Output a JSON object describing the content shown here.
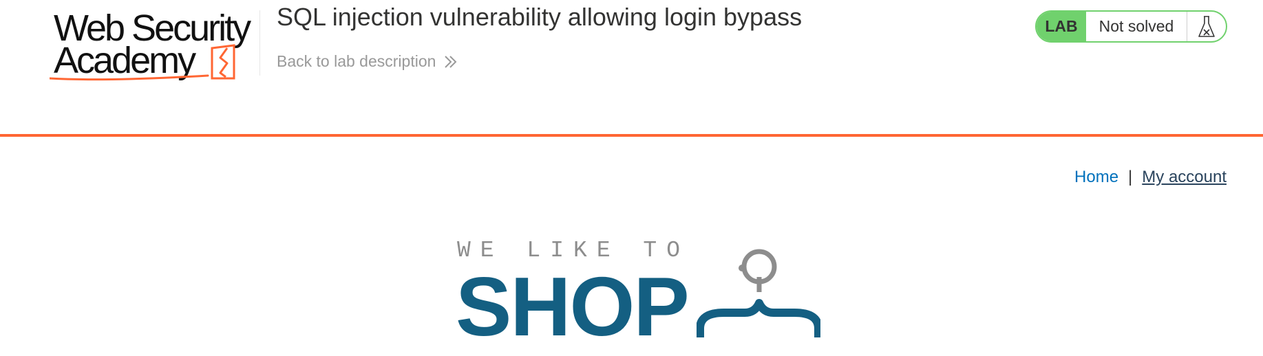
{
  "header": {
    "logo_line1": "Web Security",
    "logo_line2": "Academy",
    "lab_title": "SQL injection vulnerability allowing login bypass",
    "back_link": "Back to lab description",
    "status": {
      "lab_tag": "LAB",
      "state": "Not solved",
      "color": "#70d16d"
    },
    "rule_color": "#ff6633"
  },
  "nav": {
    "home": "Home",
    "separator": "|",
    "my_account": "My account"
  },
  "shop_logo": {
    "tagline": "WE LIKE TO",
    "word": "SHOP",
    "color": "#145f82"
  }
}
